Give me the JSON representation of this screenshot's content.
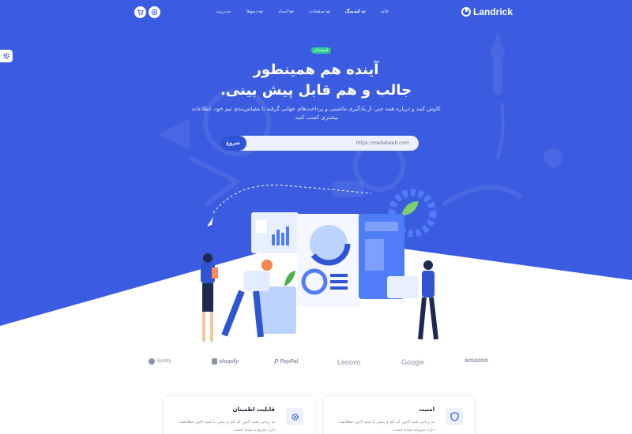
{
  "brand": {
    "name": "Landrick"
  },
  "nav": {
    "items": [
      {
        "label": "خانه",
        "has_dropdown": false,
        "active": false
      },
      {
        "label": "لندینگ",
        "has_dropdown": true,
        "active": true
      },
      {
        "label": "صفحات",
        "has_dropdown": true,
        "active": false
      },
      {
        "label": "اسناد",
        "has_dropdown": true,
        "active": false
      },
      {
        "label": "دموها",
        "has_dropdown": true,
        "active": false
      },
      {
        "label": "مدیریت",
        "has_dropdown": false,
        "active": false
      }
    ],
    "buttons": {
      "cart_icon": "cart-icon",
      "user_icon": "user-icon"
    }
  },
  "settings": {
    "icon": "gear-icon"
  },
  "hero": {
    "badge": "استخدام",
    "title_line1": "آینده هم همینطور",
    "title_line2": "جالب و هم قابل پیش بینی.",
    "description": "کاوش کنید و درباره همه چیز، از یادگیری ماشینی و پرداخت‌های جهانی گرفته تا مقیاس‌بندی تیم خود، اطلاعات بیشتری کسب کنید."
  },
  "search": {
    "placeholder": "https://mellatweb.com",
    "value": "",
    "button_label": "شروع"
  },
  "partners": [
    "Spotify",
    "shopify",
    "PayPal",
    "Lenovo",
    "Google",
    "amazon"
  ],
  "features": [
    {
      "title": "امنیت",
      "description": "به زبانی شبه لاتین که کم و بیش با شبه لاتین مطابقت دارد سروده شده است.",
      "icon": "shield-icon"
    },
    {
      "title": "قابلیت اطمینان",
      "description": "به زبانی شبه لاتین که کم و بیش با شبه لاتین مطابقت دارد سروده شده است.",
      "icon": "cog-icon"
    }
  ],
  "colors": {
    "primary": "#2f55d4",
    "hero_bg": "#3b5ce0",
    "badge": "#2eca8b",
    "text_dark": "#161c2d",
    "text_muted": "#8492a6"
  }
}
